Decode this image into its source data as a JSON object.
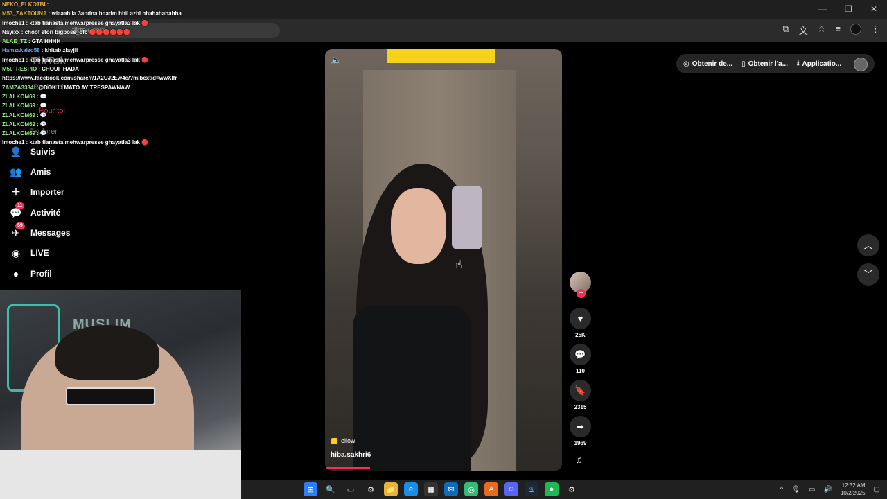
{
  "browser": {
    "url": "tiktok.com",
    "window_controls": [
      "—",
      "❐",
      "✕"
    ]
  },
  "chat": [
    {
      "user": "NEKO_ELKOTBI",
      "msg": "",
      "color": "#e8b04b"
    },
    {
      "user": "M53_ZAKTOUNA",
      "msg": "wlaaahila 3andna bnadm hbil azbi hhahahahahha",
      "color": "#d6b21f"
    },
    {
      "user": "lmoche1",
      "msg": "ktab fianasta mehwarpresse ghayatla3 lak 🔴",
      "color": "#ffffff"
    },
    {
      "user": "Nayixx",
      "msg": "choof stori bigboss_ofc 🔴🔴🔴🔴🔴🔴",
      "color": "#ffffff"
    },
    {
      "user": "ALAE_TZ",
      "msg": "GTA HHHH",
      "color": "#8ef07a"
    },
    {
      "user": "Hamzakaizo58",
      "msg": "khitab zlayjii",
      "color": "#6ea8ff"
    },
    {
      "user": "lmoche1",
      "msg": "ktab fianasta mehwarpresse ghayatla3 lak 🔴",
      "color": "#ffffff"
    },
    {
      "user": "M50_RESPIO",
      "msg": "CHOUF HADA",
      "color": "#8ef07a"
    },
    {
      "user": "",
      "msg": "https://www.facebook.com/share/r/1A2UJ2Ew4e/?mibextid=wwXIfr",
      "color": "#ffffff"
    },
    {
      "user": "7AMZA3334",
      "msg": "@DOK LI MATO AY TRESPAWNAW",
      "color": "#8ef07a"
    },
    {
      "user": "ZLALKOM69",
      "msg": "💬",
      "color": "#8ef07a"
    },
    {
      "user": "ZLALKOM69",
      "msg": "💬",
      "color": "#8ef07a"
    },
    {
      "user": "ZLALKOM69",
      "msg": "💬",
      "color": "#8ef07a"
    },
    {
      "user": "ZLALKOM69",
      "msg": "💬",
      "color": "#8ef07a"
    },
    {
      "user": "ZLALKOM69",
      "msg": "💬",
      "color": "#8ef07a"
    },
    {
      "user": "lmoche1",
      "msg": "ktab fianasta mehwarpresse ghayatla3 lak 🔴",
      "color": "#ffffff"
    }
  ],
  "nav_ghost": {
    "logo": "TikTok",
    "search": "Rechercher",
    "foryou": "Pour toi",
    "explore": "Explorer"
  },
  "nav": [
    {
      "label": "Suivis",
      "icon": "👤"
    },
    {
      "label": "Amis",
      "icon": "👥"
    },
    {
      "label": "Importer",
      "icon": "＋"
    },
    {
      "label": "Activité",
      "icon": "💬",
      "badge": "11"
    },
    {
      "label": "Messages",
      "icon": "✈",
      "badge": "59"
    },
    {
      "label": "LIVE",
      "icon": "◉"
    },
    {
      "label": "Profil",
      "icon": "●"
    }
  ],
  "webcam": {
    "sign_text": "MUSLIM"
  },
  "video": {
    "sound_tag": "ellow",
    "username": "hiba.sakhri6",
    "progress_fraction": 0.19
  },
  "actions": {
    "likes": "25K",
    "comments": "110",
    "saves": "2315",
    "shares": "1969"
  },
  "top_pills": {
    "item1": "Obtenir de...",
    "item2": "Obtenir l'a...",
    "item3": "Applicatio..."
  },
  "taskbar": {
    "time": "12:32 AM",
    "date": "10/2/2025",
    "apps": [
      "⊞",
      "🔍",
      "▭",
      "⚙",
      "📁",
      "e",
      "▦",
      "✉",
      "◎",
      "A",
      "☺",
      "♨",
      "●",
      "⚙"
    ]
  },
  "colors": {
    "accent": "#fe2c55",
    "bg": "#000000"
  }
}
